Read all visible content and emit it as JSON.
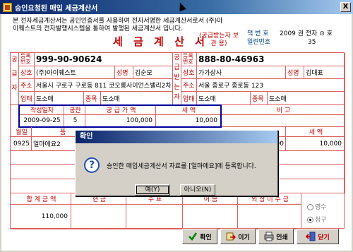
{
  "window": {
    "title": "승인요청된 매입 세금계산서",
    "close_label": "X"
  },
  "intro": "본 전자세금계산서는 공인인증서를 사용하여 전자서명한 세금계산서로서 (주)아이퀘스트의 전자발행시스템을 통하여 발행된 세금계산서 입니다.",
  "doc": {
    "title": "세 금 계 산 서",
    "subtitle": "(공급받는자 보 관 용)"
  },
  "book": {
    "book_label": "책 번 호",
    "book_value": "2009 권 전자 ⊙ 호",
    "serial_label": "일련번호",
    "serial_value": "35"
  },
  "supplier": {
    "side_label": "공급자",
    "reg_label": "등록번호",
    "reg_no": "999-90-90624",
    "name_label": "상호",
    "name": "(주)아이퀘스트",
    "rep_label": "성명",
    "rep": "김순모",
    "addr_label": "주소",
    "addr": "서울시 구로구 구로동 811 코오롱사이언스밸리2차 1008",
    "biz_label": "업태",
    "biz": "도소매",
    "item_label": "종목",
    "item": "도소매"
  },
  "buyer": {
    "side_label": "공급받는자",
    "reg_label": "등록번호",
    "reg_no": "888-80-46963",
    "name_label": "상호",
    "name": "가가상사",
    "rep_label": "성명",
    "rep": "김대표",
    "addr_label": "주소",
    "addr": "서울 종로구 종로동 123",
    "biz_label": "업태",
    "biz": "도소매",
    "item_label": "종목",
    "item": "도소매"
  },
  "summary": {
    "date_label": "작성일자",
    "blank_label": "공란",
    "amount_label": "공 급 가 액",
    "tax_label": "세 액",
    "note_label": "비 고",
    "date": "2009-09-25",
    "blank": "5",
    "amount": "100,000",
    "tax": "10,000"
  },
  "lines": {
    "month_label": "월일",
    "item_label": "품",
    "tax_label": "세 액",
    "rows": [
      {
        "date": "0925",
        "item": "얼마에요2",
        "amount": "000",
        "tax": "10,000"
      }
    ]
  },
  "totals": {
    "total_label": "합 계 금 액",
    "cash_label": "현 금",
    "check_label": "수 표",
    "note_label": "어 음",
    "credit_label": "외 상 미 수 금",
    "total": "110,000",
    "receipt_label": "영수",
    "claim_label": "청구"
  },
  "dialog": {
    "title": "확인",
    "message": "승인한 매입세금계산서 자료를 [얼마에요]에 등록합니다.",
    "yes_label": "예(Y)",
    "no_label": "아니오(N)"
  },
  "toolbar": {
    "confirm": "확인",
    "save": "이기",
    "print": "인쇄",
    "close": "닫기"
  }
}
